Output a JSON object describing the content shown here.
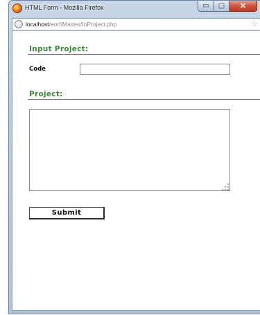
{
  "window": {
    "title": "HTML Form - Mozilla Firefox",
    "minimize_glyph": "▭",
    "maximize_glyph": "▢",
    "close_glyph": "✕"
  },
  "address_bar": {
    "host": "localhost",
    "path": "/eorf/Master/InProject.php",
    "bookmark_glyph": "☆"
  },
  "form": {
    "input_heading": "Input Project:",
    "code_label": "Code",
    "code_value": "",
    "project_heading": "Project:",
    "project_value": "",
    "submit_label": "Submit"
  },
  "colors": {
    "heading": "#3a8a3a",
    "close_button": "#c0391f"
  },
  "icons": {
    "app": "firefox-icon",
    "site": "globe-icon",
    "bookmark": "star-icon",
    "textarea_resize": "resize-grip-icon"
  }
}
